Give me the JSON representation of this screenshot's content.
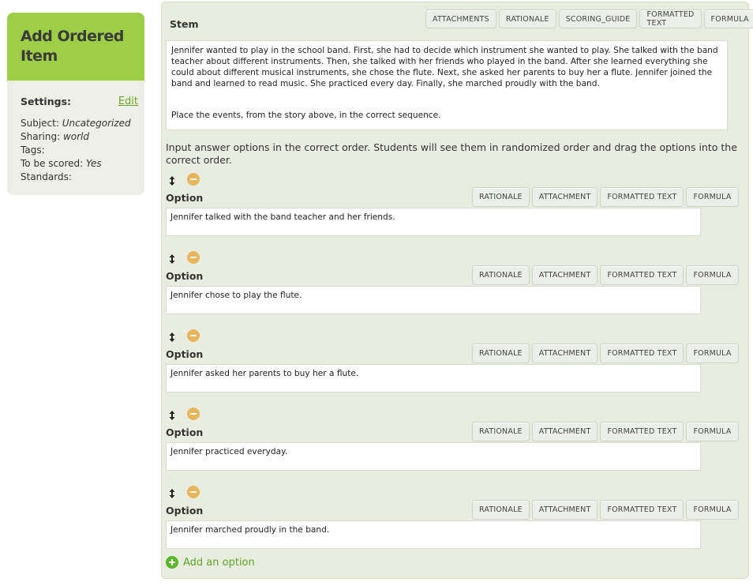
{
  "sidebar": {
    "title": "Add Ordered Item",
    "settings_label": "Settings:",
    "edit_label": "Edit",
    "fields": [
      {
        "label": "Subject: ",
        "value": "Uncategorized",
        "italic": true
      },
      {
        "label": "Sharing: ",
        "value": "world",
        "italic": true
      },
      {
        "label": "Tags:",
        "value": "",
        "italic": false
      },
      {
        "label": "To be scored: ",
        "value": "Yes",
        "italic": true
      },
      {
        "label": "Standards:",
        "value": "",
        "italic": false
      }
    ]
  },
  "stem": {
    "label": "Stem",
    "buttons": [
      "ATTACHMENTS",
      "RATIONALE",
      "SCORING_GUIDE",
      "FORMATTED TEXT",
      "FORMULA"
    ],
    "passage": "Jennifer wanted to play in the school band. First, she had to decide which instrument she wanted to play. She talked with the band teacher about different instruments. Then, she talked with her friends who played in the band. After she learned everything she could about different musical instruments, she chose the flute. Next, she asked her parents to buy her a flute. Jennifer joined the band and learned to read music. She practiced every day. Finally, she marched proudly with the band.",
    "question": "Place the events, from the story above, in the correct sequence."
  },
  "instructions": "Input answer options in the correct order. Students will see them in randomized order and drag the options into the correct order.",
  "option_buttons": [
    "RATIONALE",
    "ATTACHMENT",
    "FORMATTED TEXT",
    "FORMULA"
  ],
  "options": [
    {
      "label": "Option",
      "value": "Jennifer talked with the band teacher and her friends."
    },
    {
      "label": "Option",
      "value": "Jennifer chose to play the flute."
    },
    {
      "label": "Option",
      "value": "Jennifer asked her parents to buy her a flute."
    },
    {
      "label": "Option",
      "value": "Jennifer practiced everyday."
    },
    {
      "label": "Option",
      "value": "Jennifer marched proudly in the band."
    }
  ],
  "add_option_label": "Add an option"
}
